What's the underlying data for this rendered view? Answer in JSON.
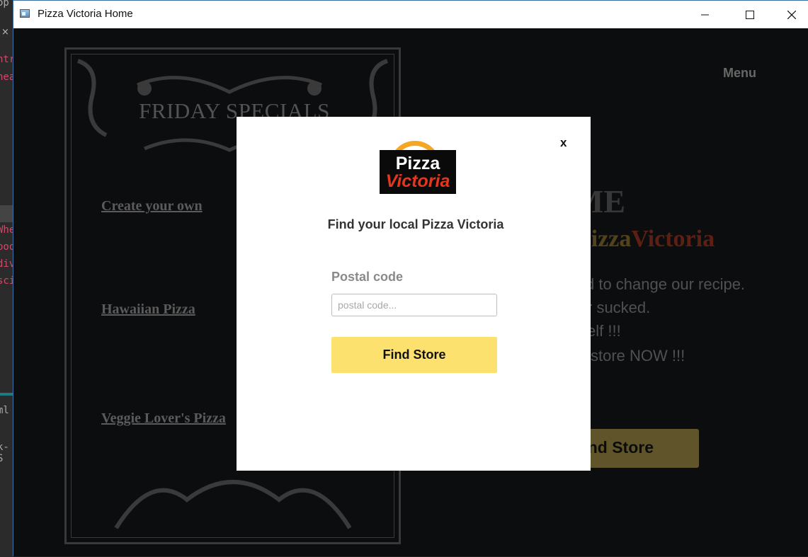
{
  "window": {
    "title": "Pizza Victoria Home"
  },
  "editor_remnant": {
    "lines": [
      "ntr",
      "hea",
      "Whe",
      "boo",
      "div",
      "sci",
      "ml",
      "k-S"
    ],
    "close_glyph": "×",
    "top_label": "op"
  },
  "page": {
    "specials": {
      "title": "FRIDAY SPECIALS",
      "items": [
        "Create your own",
        "Hawaiian Pizza",
        "Veggie Lover's Pizza"
      ]
    },
    "nav": {
      "menu_label": "Menu"
    },
    "hero": {
      "welcome": "ME",
      "brand_pizza": "Pizza",
      "brand_victoria": "Victoria",
      "pitch_lines": [
        "d to change our recipe.",
        "r sucked.",
        "elf !!!",
        "store NOW !!!"
      ],
      "cta_label": "nd Store"
    }
  },
  "modal": {
    "close_label": "x",
    "logo": {
      "word1": "Pizza",
      "word2": "Victoria"
    },
    "heading": "Find your local Pizza Victoria",
    "postal_label": "Postal code",
    "postal_placeholder": "postal code...",
    "postal_value": "",
    "submit_label": "Find Store"
  },
  "colors": {
    "accent_yellow": "#fde16f",
    "logo_orange": "#f5a623",
    "logo_red": "#e4361d",
    "page_bg": "#111214"
  }
}
